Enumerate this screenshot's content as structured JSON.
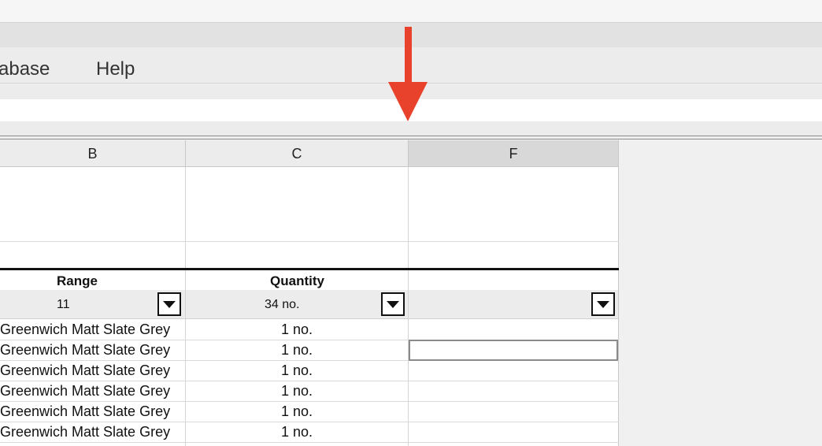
{
  "menubar": {
    "items": [
      "abase",
      "Help"
    ]
  },
  "grid": {
    "columns": [
      "B",
      "C",
      "F"
    ],
    "selected_column": "F",
    "headers": {
      "b": "Range",
      "c": "Quantity",
      "f": ""
    },
    "filters": {
      "b": "11",
      "c": "34 no.",
      "f": ""
    },
    "rows": [
      {
        "b": "Greenwich Matt Slate Grey",
        "c": "1 no.",
        "f": ""
      },
      {
        "b": "Greenwich Matt Slate Grey",
        "c": "1 no.",
        "f": ""
      },
      {
        "b": "Greenwich Matt Slate Grey",
        "c": "1 no.",
        "f": ""
      },
      {
        "b": "Greenwich Matt Slate Grey",
        "c": "1 no.",
        "f": ""
      },
      {
        "b": "Greenwich Matt Slate Grey",
        "c": "1 no.",
        "f": ""
      },
      {
        "b": "Greenwich Matt Slate Grey",
        "c": "1 no.",
        "f": ""
      }
    ],
    "active_cell_row": 2
  },
  "annotation": {
    "icon": "down-arrow-icon",
    "color": "#e8412c"
  }
}
